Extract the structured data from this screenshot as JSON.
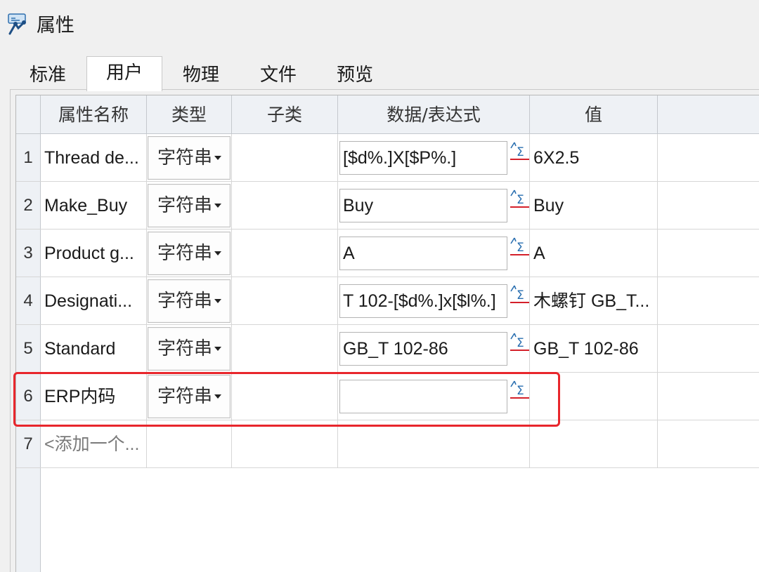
{
  "window": {
    "title": "属性"
  },
  "tabs": [
    {
      "label": "标准",
      "active": false
    },
    {
      "label": "用户",
      "active": true
    },
    {
      "label": "物理",
      "active": false
    },
    {
      "label": "文件",
      "active": false
    },
    {
      "label": "预览",
      "active": false
    }
  ],
  "table": {
    "headers": {
      "name": "属性名称",
      "type": "类型",
      "subtype": "子类",
      "expression": "数据/表达式",
      "value": "值"
    },
    "rows": [
      {
        "num": "1",
        "name": "Thread de...",
        "type": "字符串",
        "subtype": "",
        "expression": "[$d%.]X[$P%.]",
        "value": "6X2.5"
      },
      {
        "num": "2",
        "name": "Make_Buy",
        "type": "字符串",
        "subtype": "",
        "expression": "Buy",
        "value": "Buy"
      },
      {
        "num": "3",
        "name": "Product g...",
        "type": "字符串",
        "subtype": "",
        "expression": "A",
        "value": "A"
      },
      {
        "num": "4",
        "name": "Designati...",
        "type": "字符串",
        "subtype": "",
        "expression": "T 102-[$d%.]x[$l%.]",
        "value": "木螺钉 GB_T..."
      },
      {
        "num": "5",
        "name": "Standard",
        "type": "字符串",
        "subtype": "",
        "expression": "GB_T 102-86",
        "value": "GB_T 102-86"
      },
      {
        "num": "6",
        "name": "ERP内码",
        "type": "字符串",
        "subtype": "",
        "expression": "",
        "value": ""
      }
    ],
    "add_row": {
      "num": "7",
      "placeholder": "<添加一个..."
    }
  },
  "colors": {
    "highlight": "#e8262c",
    "expression_icon_underline": "#d4202a",
    "expression_icon_glyph": "#2a6fb0"
  },
  "icons": {
    "app": "attributes-tool-icon",
    "expression_button": "sigma-expression-icon",
    "combo_arrow": "dropdown-caret-icon"
  }
}
